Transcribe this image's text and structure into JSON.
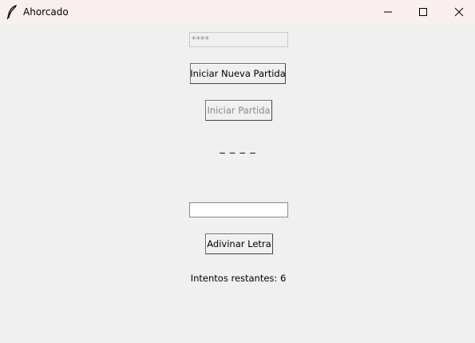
{
  "window": {
    "title": "Ahorcado",
    "icon": "feather-icon",
    "controls": [
      "minimize-icon",
      "maximize-icon",
      "close-icon"
    ]
  },
  "secret_field": {
    "value": "****",
    "state": "disabled"
  },
  "new_game_button": {
    "label": "Iniciar Nueva Partida"
  },
  "start_button": {
    "label": "Iniciar Partida",
    "state": "disabled"
  },
  "word_display": {
    "text": "_ _ _ _"
  },
  "letter_field": {
    "value": ""
  },
  "guess_button": {
    "label": "Adivinar Letra"
  },
  "attempts": {
    "text": "Intentos restantes: 6"
  },
  "colors": {
    "titlebar": "#f9efee",
    "background": "#f0f0f0",
    "disabled_text": "#8a8a8a"
  }
}
